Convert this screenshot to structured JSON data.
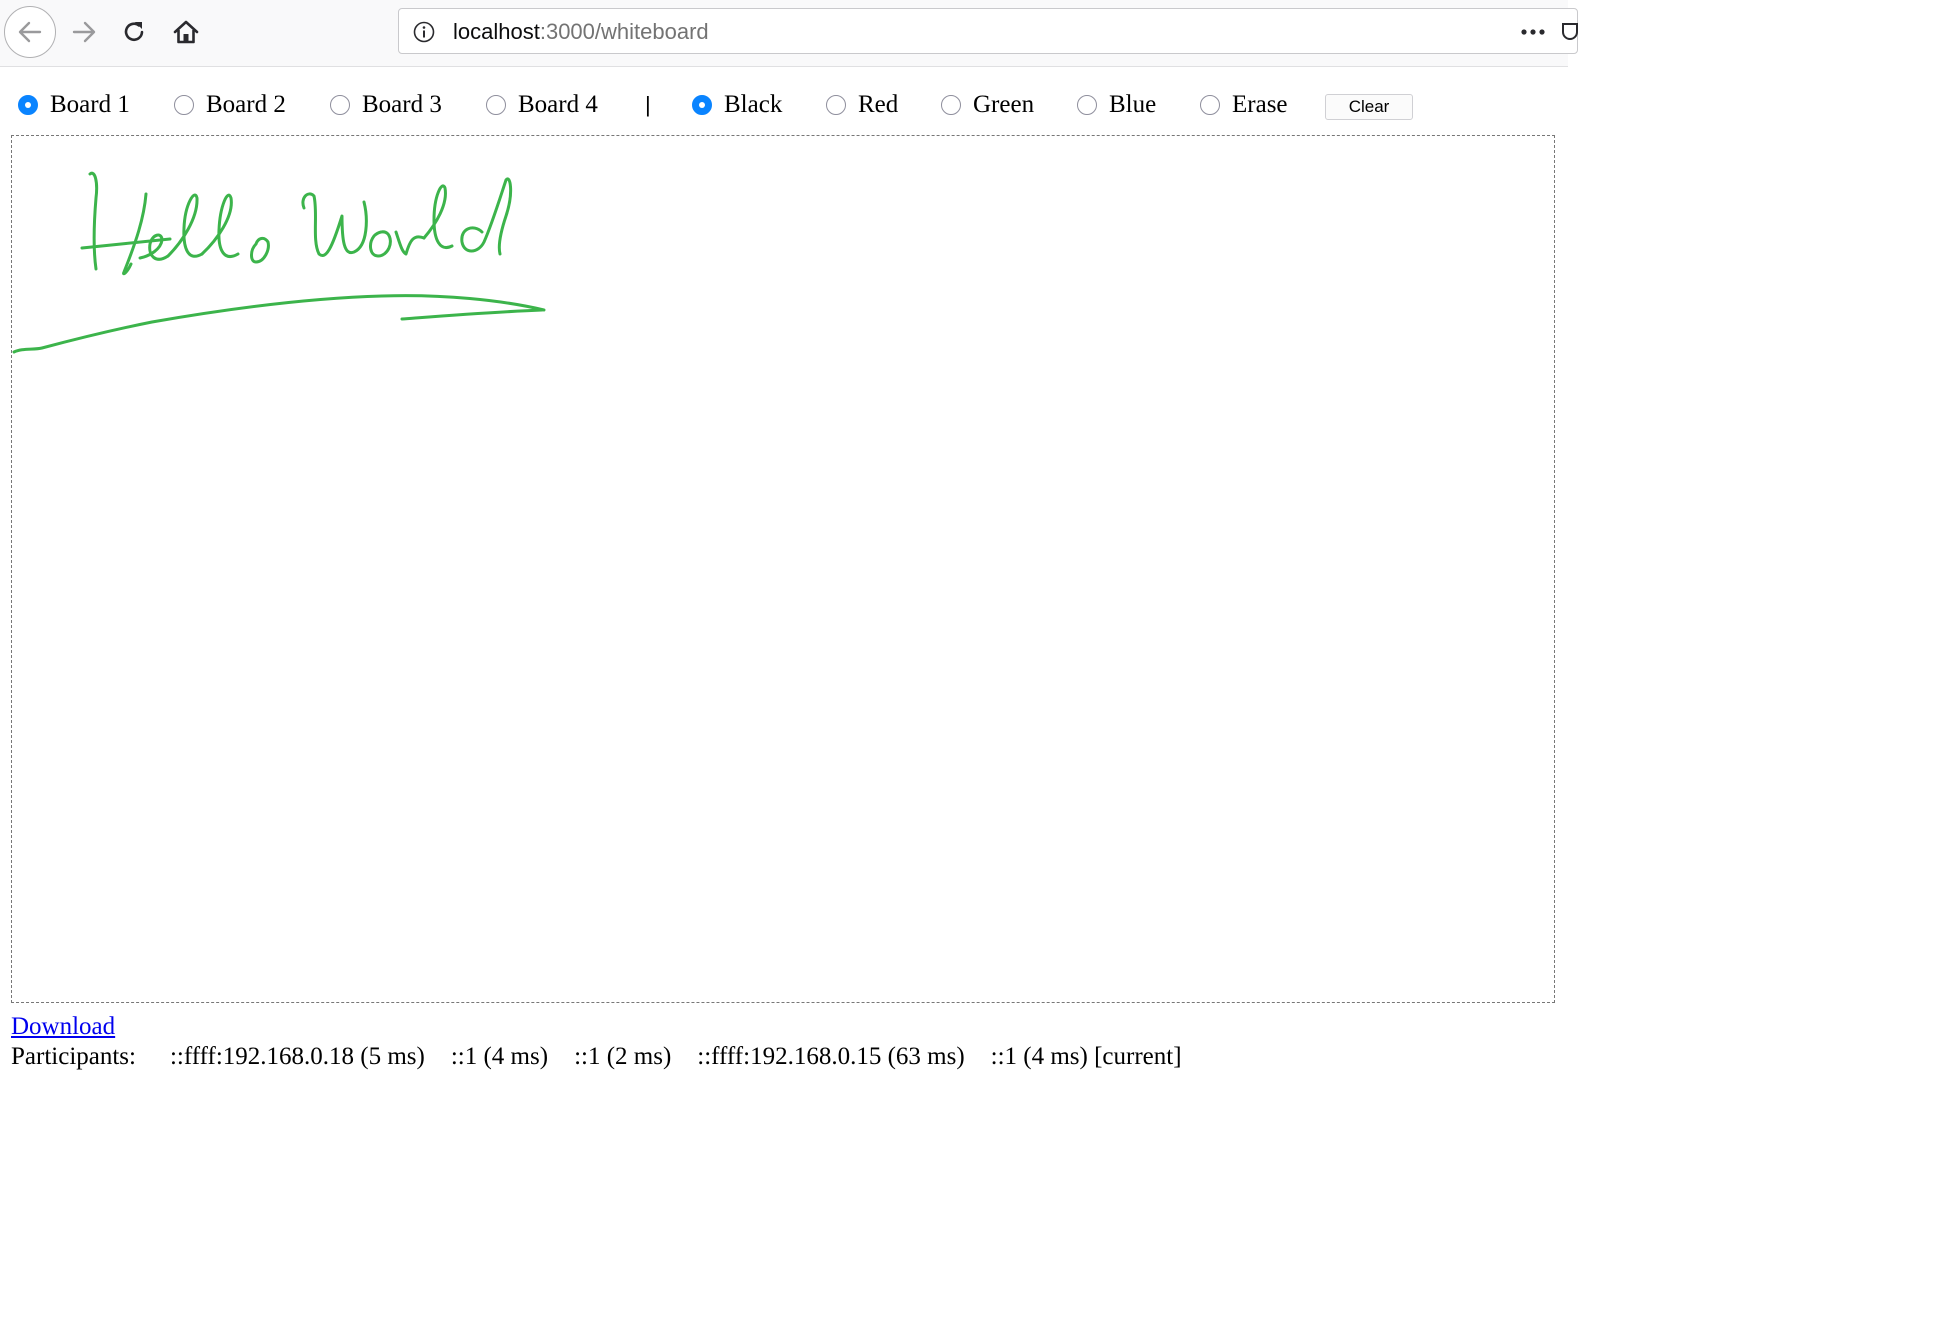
{
  "browser": {
    "url_host": "localhost",
    "url_path": ":3000/whiteboard"
  },
  "boards": [
    {
      "label": "Board 1",
      "checked": true
    },
    {
      "label": "Board 2",
      "checked": false
    },
    {
      "label": "Board 3",
      "checked": false
    },
    {
      "label": "Board 4",
      "checked": false
    }
  ],
  "separator": "|",
  "colors": [
    {
      "label": "Black",
      "checked": true
    },
    {
      "label": "Red",
      "checked": false
    },
    {
      "label": "Green",
      "checked": false
    },
    {
      "label": "Blue",
      "checked": false
    },
    {
      "label": "Erase",
      "checked": false
    }
  ],
  "clear_label": "Clear",
  "drawing": {
    "stroke_color": "#3cb44b",
    "handwritten_text": "Hello World"
  },
  "footer": {
    "download_label": "Download",
    "participants_label": "Participants:",
    "participants": [
      "::ffff:192.168.0.18 (5 ms)",
      "::1 (4 ms)",
      "::1 (2 ms)",
      "::ffff:192.168.0.15 (63 ms)",
      "::1 (4 ms) [current]"
    ]
  },
  "accent_color": "#0a84ff"
}
